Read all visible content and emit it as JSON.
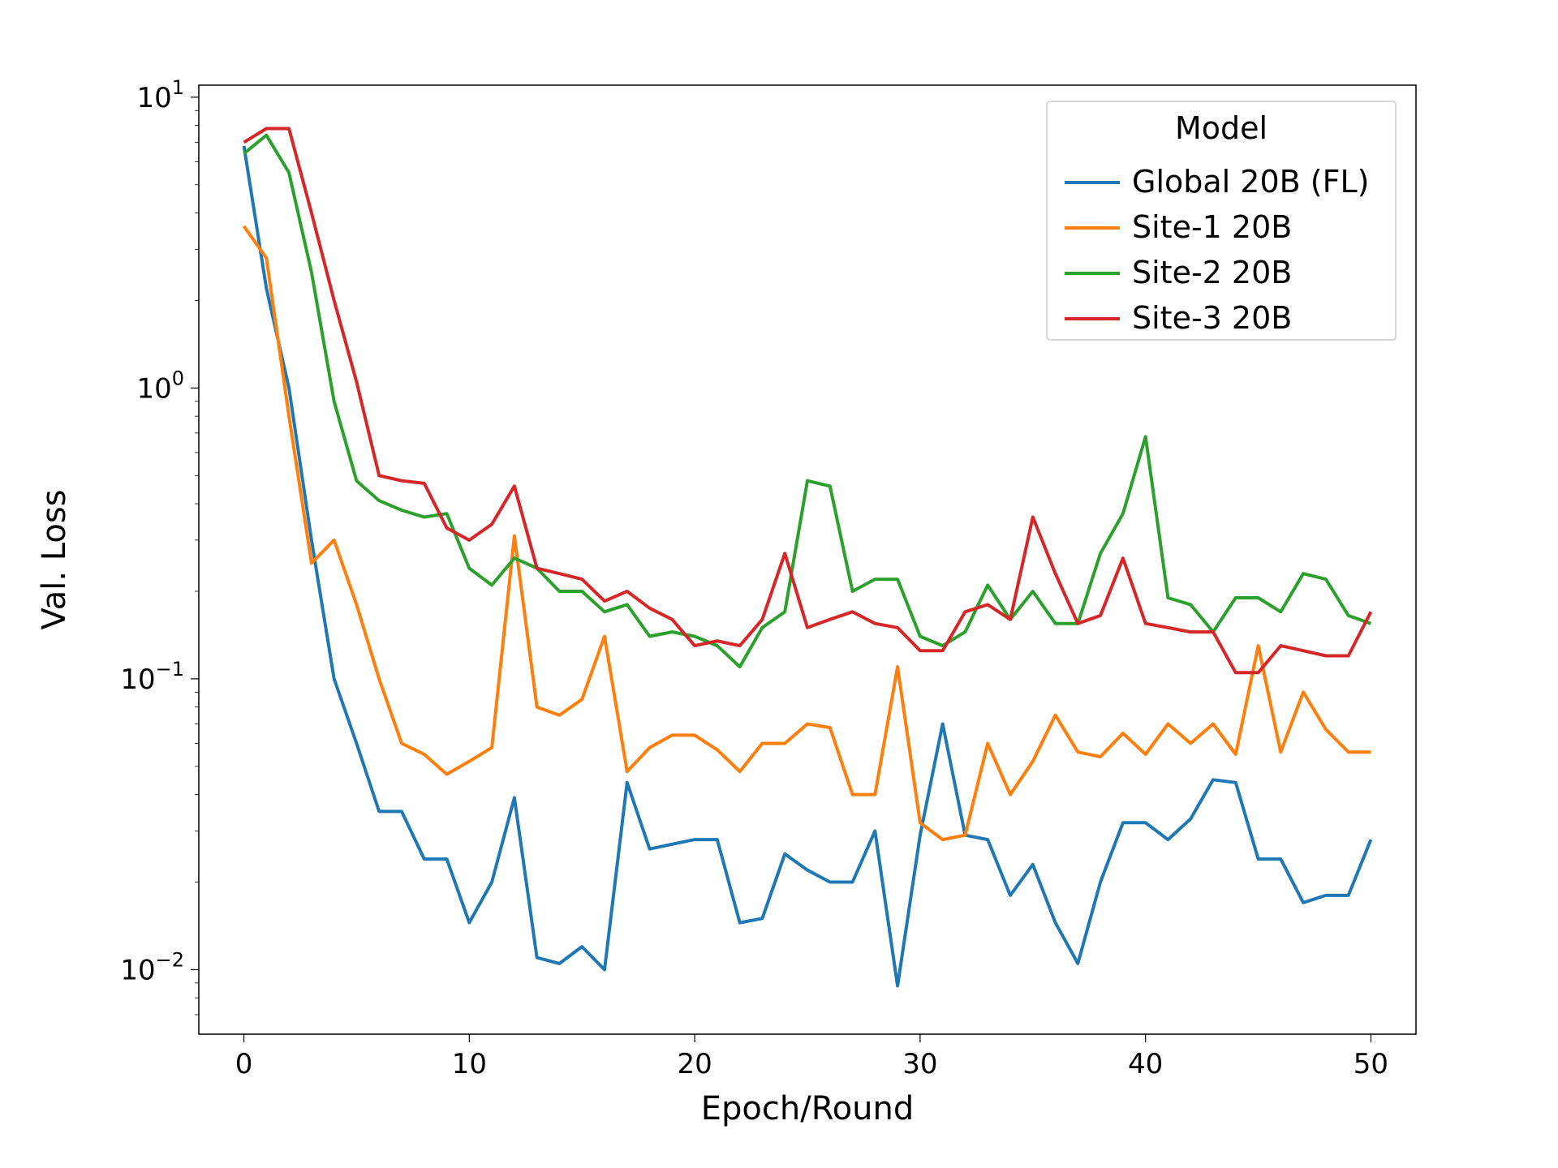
{
  "chart_data": {
    "type": "line",
    "xlabel": "Epoch/Round",
    "ylabel": "Val. Loss",
    "xlim": [
      -2,
      52
    ],
    "ylim": [
      0.006,
      11
    ],
    "yscale": "log",
    "x_ticks": [
      0,
      10,
      20,
      30,
      40,
      50
    ],
    "y_ticks": [
      0.01,
      0.1,
      1,
      10
    ],
    "y_tick_labels": [
      "10⁻²",
      "10⁻¹",
      "10⁰",
      "10¹"
    ],
    "legend_title": "Model",
    "x": [
      0,
      1,
      2,
      3,
      4,
      5,
      6,
      7,
      8,
      9,
      10,
      11,
      12,
      13,
      14,
      15,
      16,
      17,
      18,
      19,
      20,
      21,
      22,
      23,
      24,
      25,
      26,
      27,
      28,
      29,
      30,
      31,
      32,
      33,
      34,
      35,
      36,
      37,
      38,
      39,
      40,
      41,
      42,
      43,
      44,
      45,
      46,
      47,
      48,
      49,
      50
    ],
    "series": [
      {
        "name": "Global 20B (FL)",
        "color": "#1f77b4",
        "values": [
          6.8,
          2.2,
          1.0,
          0.3,
          0.1,
          0.06,
          0.035,
          0.035,
          0.024,
          0.024,
          0.0145,
          0.02,
          0.039,
          0.011,
          0.0105,
          0.012,
          0.01,
          0.044,
          0.026,
          0.027,
          0.028,
          0.028,
          0.0145,
          0.015,
          0.025,
          0.022,
          0.02,
          0.02,
          0.03,
          0.0088,
          0.029,
          0.07,
          0.029,
          0.028,
          0.018,
          0.023,
          0.0145,
          0.0105,
          0.02,
          0.032,
          0.032,
          0.028,
          0.033,
          0.045,
          0.044,
          0.024,
          0.024,
          0.017,
          0.018,
          0.018,
          0.028
        ]
      },
      {
        "name": "Site-1 20B",
        "color": "#ff7f0e",
        "values": [
          3.6,
          2.8,
          0.8,
          0.25,
          0.3,
          0.18,
          0.1,
          0.06,
          0.055,
          0.047,
          0.052,
          0.058,
          0.31,
          0.08,
          0.075,
          0.085,
          0.14,
          0.048,
          0.058,
          0.064,
          0.064,
          0.057,
          0.048,
          0.06,
          0.06,
          0.07,
          0.068,
          0.04,
          0.04,
          0.11,
          0.032,
          0.028,
          0.029,
          0.06,
          0.04,
          0.052,
          0.075,
          0.056,
          0.054,
          0.065,
          0.055,
          0.07,
          0.06,
          0.07,
          0.055,
          0.13,
          0.056,
          0.09,
          0.067,
          0.056,
          0.056
        ]
      },
      {
        "name": "Site-2 20B",
        "color": "#2ca02c",
        "values": [
          6.4,
          7.4,
          5.5,
          2.5,
          0.9,
          0.48,
          0.41,
          0.38,
          0.36,
          0.37,
          0.24,
          0.21,
          0.26,
          0.24,
          0.2,
          0.2,
          0.17,
          0.18,
          0.14,
          0.145,
          0.14,
          0.13,
          0.11,
          0.15,
          0.17,
          0.48,
          0.46,
          0.2,
          0.22,
          0.22,
          0.14,
          0.13,
          0.145,
          0.21,
          0.16,
          0.2,
          0.155,
          0.155,
          0.27,
          0.37,
          0.68,
          0.19,
          0.18,
          0.145,
          0.19,
          0.19,
          0.17,
          0.23,
          0.22,
          0.165,
          0.155
        ]
      },
      {
        "name": "Site-3 20B",
        "color": "#d62728",
        "values": [
          7.0,
          7.8,
          7.8,
          4.0,
          2.0,
          1.05,
          0.5,
          0.48,
          0.47,
          0.33,
          0.3,
          0.34,
          0.46,
          0.24,
          0.23,
          0.22,
          0.185,
          0.2,
          0.175,
          0.16,
          0.13,
          0.135,
          0.13,
          0.16,
          0.27,
          0.15,
          0.16,
          0.17,
          0.155,
          0.15,
          0.125,
          0.125,
          0.17,
          0.18,
          0.16,
          0.36,
          0.23,
          0.155,
          0.165,
          0.26,
          0.155,
          0.15,
          0.145,
          0.145,
          0.105,
          0.105,
          0.13,
          0.125,
          0.12,
          0.12,
          0.17
        ]
      }
    ]
  }
}
